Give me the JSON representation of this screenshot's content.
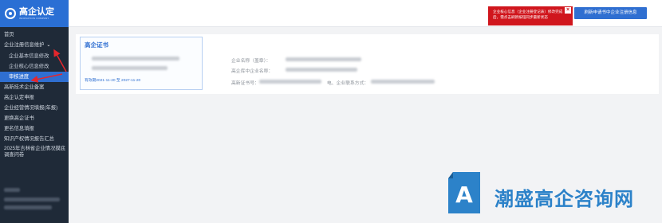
{
  "app": {
    "logo_text": "高企认定",
    "logo_sub": "INNOVATION COMPANY"
  },
  "sidebar": {
    "items": [
      {
        "label": "首页"
      },
      {
        "label": "企业注册信息维护"
      },
      {
        "label": "企业基本信息修改"
      },
      {
        "label": "企业核心信息修改"
      },
      {
        "label": "审核进度"
      },
      {
        "label": "高新技术企业备案"
      },
      {
        "label": "高企认定申报"
      },
      {
        "label": "企业经营情况填报(年报)"
      },
      {
        "label": "更换高企证书"
      },
      {
        "label": "更名信息填报"
      },
      {
        "label": "知识产权情况报告汇总"
      },
      {
        "label": "2025年吉林省企业情况摸底调查问卷"
      }
    ]
  },
  "topbar": {
    "alert_text": "企业核心信息（企业注册登记表）修改完成后，需点击刷新按钮同步最新状态",
    "alert_close": "×",
    "refresh_button": "刷新申请书中企业注册信息"
  },
  "certificate": {
    "title": "高企证书",
    "date_range": "有效期2021-11-20 至 2027-11-20"
  },
  "info": {
    "company_label": "企业名称（盖章）：",
    "credit_label": "高企库中企业名称：",
    "cert_no_label": "高新证书号：",
    "phone_label": "电、企业联系方式："
  },
  "watermark": {
    "text": "潮盛高企咨询网",
    "glyph": "A"
  },
  "colors": {
    "accent": "#2f6fd1",
    "sidebar": "#1f2a38",
    "alert": "#d0161d",
    "annotation_arrow": "#e5262c",
    "watermark": "#2c82c9"
  }
}
